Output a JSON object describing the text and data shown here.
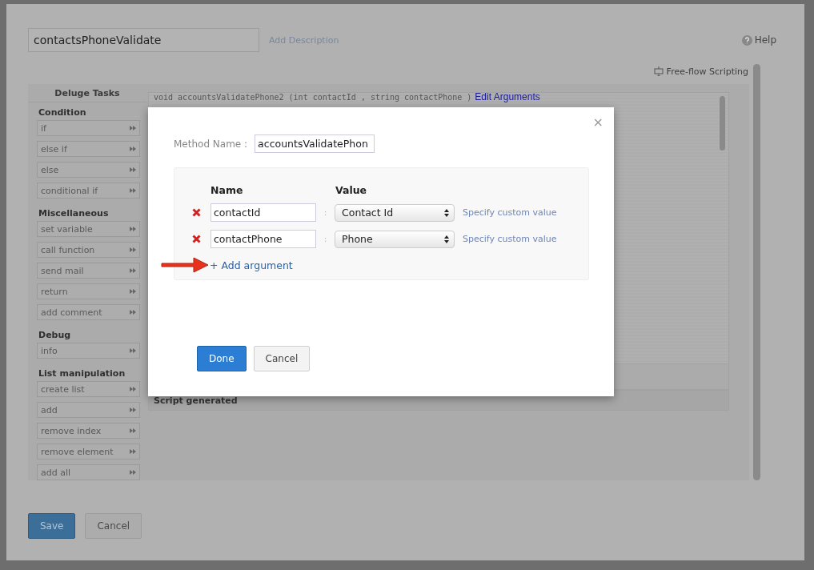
{
  "editor": {
    "function_name": "contactsPhoneValidate",
    "add_description": "Add Description",
    "help": "Help",
    "free_flow": "Free-flow Scripting",
    "tasks_title": "Deluge Tasks",
    "task_groups": [
      {
        "title": "Condition",
        "items": [
          "if",
          "else if",
          "else",
          "conditional if"
        ]
      },
      {
        "title": "Miscellaneous",
        "items": [
          "set variable",
          "call function",
          "send mail",
          "return",
          "add comment"
        ]
      },
      {
        "title": "Debug",
        "items": [
          "info"
        ]
      },
      {
        "title": "List manipulation",
        "items": [
          "create list",
          "add",
          "remove index",
          "remove element",
          "add all"
        ]
      }
    ],
    "code_line": "void accountsValidatePhone2 (int contactId , string contactPhone )",
    "edit_arguments": "Edit Arguments",
    "script_generated": "Script generated",
    "buttons": [
      {
        "label": "Save",
        "kind": "primary"
      },
      {
        "label": "Cancel",
        "kind": "secondary"
      }
    ]
  },
  "dialog": {
    "close": "×",
    "method_label": "Method Name :",
    "method_name": "accountsValidatePhon",
    "columns": [
      "Name",
      "Value"
    ],
    "arguments": [
      {
        "name": "contactId",
        "separator": ":",
        "value": "Contact Id",
        "custom": "Specify custom value"
      },
      {
        "name": "contactPhone",
        "separator": ":",
        "value": "Phone",
        "custom": "Specify custom value"
      }
    ],
    "add_argument": "+ Add argument",
    "buttons": [
      {
        "label": "Done",
        "kind": "primary"
      },
      {
        "label": "Cancel",
        "kind": "secondary"
      }
    ]
  }
}
